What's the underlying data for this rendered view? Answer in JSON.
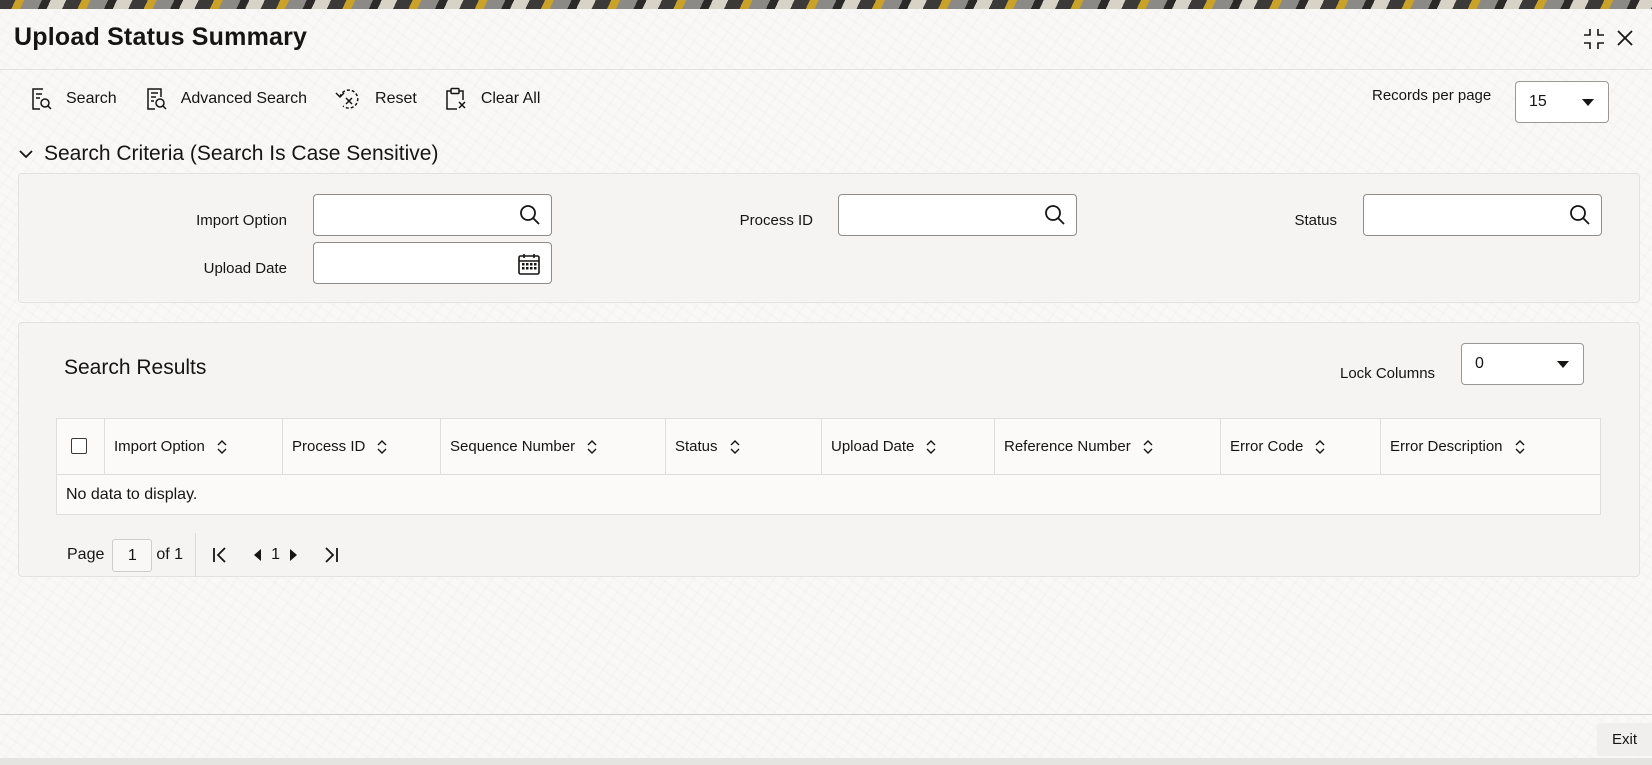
{
  "window": {
    "title": "Upload Status Summary"
  },
  "toolbar": {
    "search_label": "Search",
    "advanced_search_label": "Advanced Search",
    "reset_label": "Reset",
    "clear_all_label": "Clear All"
  },
  "records_per_page": {
    "label": "Records per page",
    "value": "15"
  },
  "search_criteria": {
    "heading": "Search Criteria (Search Is Case Sensitive)",
    "fields": {
      "import_option": {
        "label": "Import Option",
        "value": ""
      },
      "process_id": {
        "label": "Process ID",
        "value": ""
      },
      "status": {
        "label": "Status",
        "value": ""
      },
      "upload_date": {
        "label": "Upload Date",
        "value": ""
      }
    }
  },
  "results": {
    "heading": "Search Results",
    "lock_columns": {
      "label": "Lock Columns",
      "value": "0"
    },
    "columns": [
      "Import Option",
      "Process ID",
      "Sequence Number",
      "Status",
      "Upload Date",
      "Reference Number",
      "Error Code",
      "Error Description"
    ],
    "empty_text": "No data to display.",
    "pagination": {
      "page_label": "Page",
      "current_page": "1",
      "of_label": "of 1",
      "page_number": "1"
    }
  },
  "footer": {
    "exit_label": "Exit"
  },
  "icons": {
    "search": "search-icon",
    "advanced_search": "advanced-search-icon",
    "reset": "reset-icon",
    "clear_all": "clear-all-icon",
    "lookup": "magnifier-icon",
    "calendar": "calendar-icon",
    "collapse": "chevron-down-icon",
    "minimize": "collapse-icon",
    "close": "close-icon",
    "sort": "sort-icon"
  }
}
